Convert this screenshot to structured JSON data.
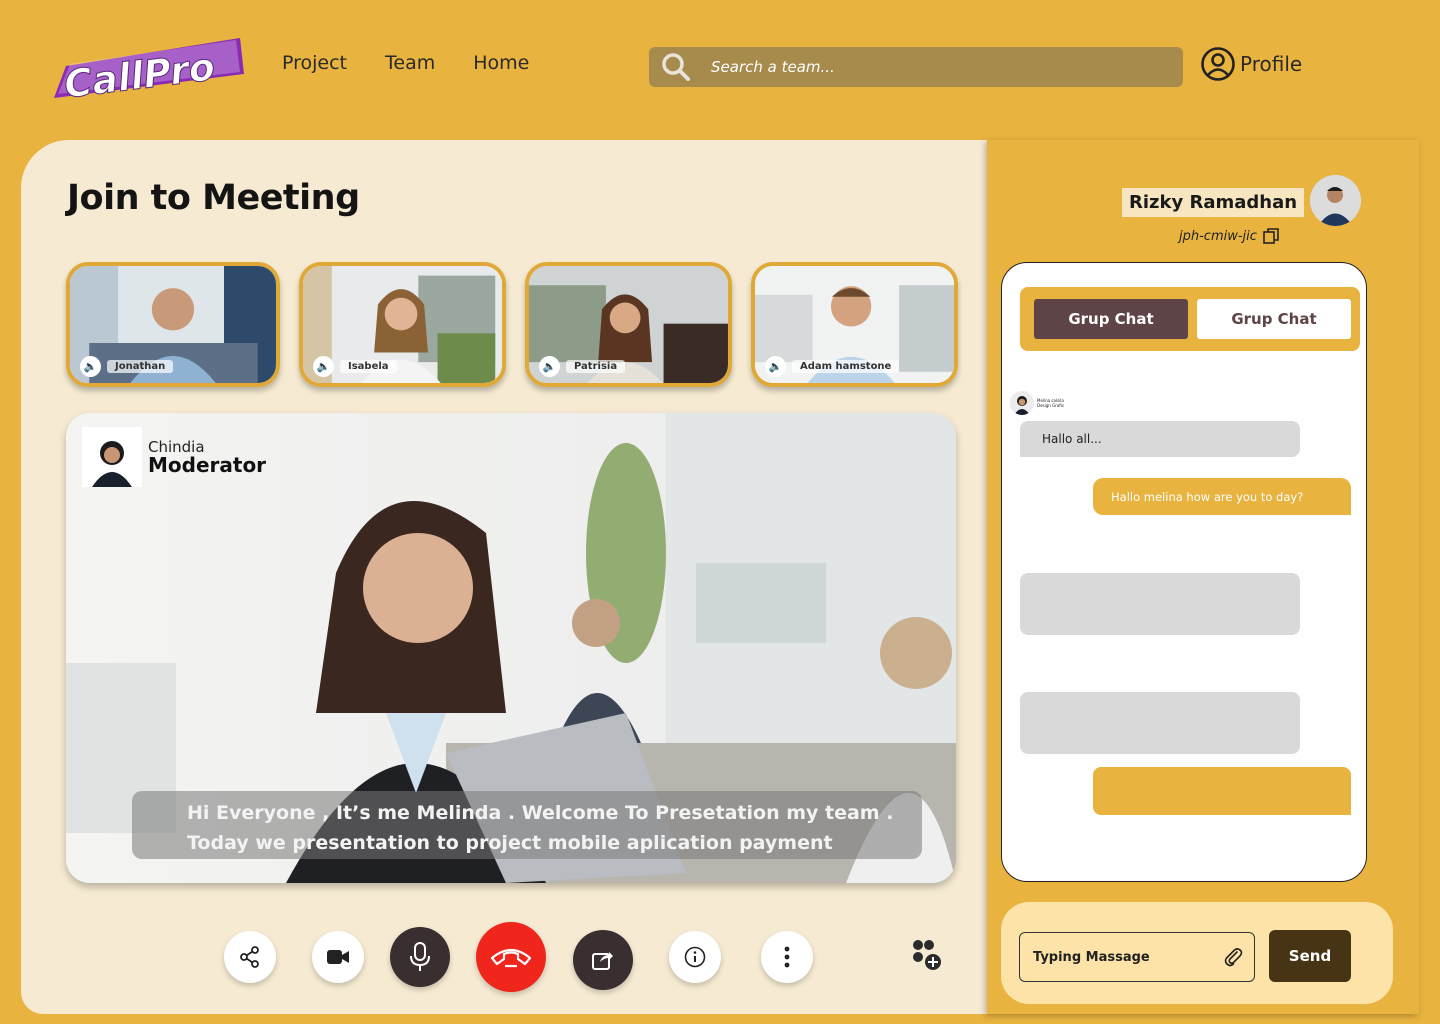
{
  "app": {
    "logo_text": "CallPro"
  },
  "nav": {
    "items": [
      {
        "label": "Project"
      },
      {
        "label": "Team"
      },
      {
        "label": "Home"
      }
    ]
  },
  "search": {
    "placeholder": "Search a team..."
  },
  "profile": {
    "label": "Profile"
  },
  "meeting": {
    "title": "Join to Meeting",
    "participants": [
      {
        "name": "Jonathan"
      },
      {
        "name": "Isabela"
      },
      {
        "name": "Patrisia"
      },
      {
        "name": "Adam hamstone"
      }
    ],
    "moderator": {
      "name": "Chindia",
      "role": "Moderator"
    },
    "caption": {
      "line1": "Hi Everyone , It’s me Melinda . Welcome To Presetation my team .",
      "line2": "Today we presentation to project mobile aplication payment"
    }
  },
  "controls": [
    {
      "name": "share-icon"
    },
    {
      "name": "video-camera-icon"
    },
    {
      "name": "microphone-icon"
    },
    {
      "name": "end-call-icon"
    },
    {
      "name": "screen-share-icon"
    },
    {
      "name": "info-icon"
    },
    {
      "name": "more-vertical-icon"
    },
    {
      "name": "add-participants-icon"
    }
  ],
  "chat_panel": {
    "user_name": "Rizky Ramadhan",
    "meeting_code": "jph-cmiw-jic",
    "tabs": [
      {
        "label": "Grup Chat",
        "active": true
      },
      {
        "label": "Grup Chat",
        "active": false
      }
    ],
    "messages": [
      {
        "sender": "Melina salsila",
        "sender_role": "Design Grafis",
        "text": "Hallo all...",
        "side": "left"
      },
      {
        "text": "Hallo melina how are you to day?",
        "side": "right"
      }
    ],
    "input": {
      "placeholder": "Typing Massage"
    },
    "send_label": "Send"
  },
  "colors": {
    "background": "#E8B33F",
    "panel": "#F6EBD2",
    "end_call": "#F0251C",
    "dark": "#3A2F30",
    "send": "#463414"
  }
}
